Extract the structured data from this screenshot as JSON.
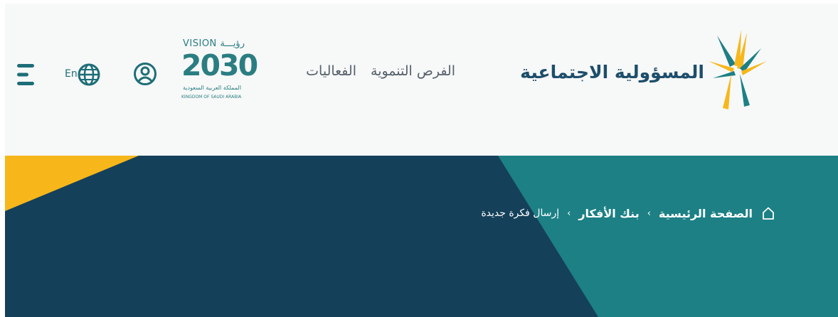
{
  "header": {
    "logo_text": "المسؤولية الاجتماعية",
    "nav": [
      {
        "label": "الفرص التنموية"
      },
      {
        "label": "الفعاليات"
      }
    ],
    "vision": {
      "top": "VISION رؤيـــة",
      "year": "2030",
      "arabic": "المملكة العربية السعودية",
      "english": "KINGDOM OF SAUDI ARABIA"
    },
    "language_label": "En",
    "icons": {
      "user": "user-circle-icon",
      "language": "globe-icon",
      "menu": "hamburger-menu-icon"
    }
  },
  "breadcrumb": {
    "items": [
      {
        "label": "الصفحة الرئيسية"
      },
      {
        "label": "بنك الأفكار"
      }
    ],
    "current": "إرسال فكرة جديدة",
    "separator": "‹",
    "home_icon": "home-icon"
  },
  "colors": {
    "header_bg": "#f7f8f8",
    "hero_navy": "#15405a",
    "hero_teal": "#1c8085",
    "accent_yellow": "#f7b71b",
    "brand_text": "#1d4e6b"
  }
}
